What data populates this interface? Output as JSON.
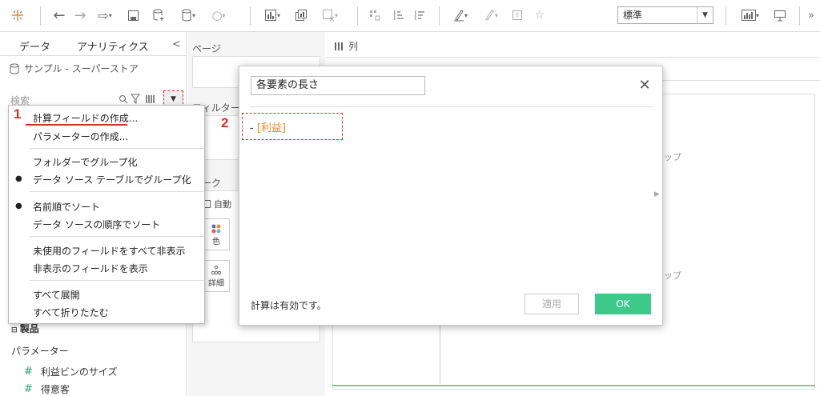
{
  "toolbar": {
    "style_select_value": "標準"
  },
  "left_pane": {
    "tabs": [
      {
        "label": "データ"
      },
      {
        "label": "アナリティクス"
      }
    ],
    "collapse_glyph": "<",
    "datasource": "サンプル - スーパーストア",
    "search_placeholder": "検索",
    "folded_row": "製品",
    "parameters_header": "パラメーター",
    "parameters": [
      {
        "label": "利益ビンのサイズ"
      },
      {
        "label": "得意客"
      }
    ]
  },
  "context_menu": {
    "items": [
      {
        "label": "計算フィールドの作成..."
      },
      {
        "label": "パラメーターの作成..."
      },
      {
        "label": "フォルダーでグループ化"
      },
      {
        "label": "データ ソース テーブルでグループ化"
      },
      {
        "label": "名前順でソート"
      },
      {
        "label": "データ ソースの順序でソート"
      },
      {
        "label": "未使用のフィールドをすべて非表示"
      },
      {
        "label": "非表示のフィールドを表示"
      },
      {
        "label": "すべて展開"
      },
      {
        "label": "すべて折りたたむ"
      }
    ]
  },
  "steps": {
    "step1": "1",
    "step2": "2"
  },
  "mid_pane": {
    "pages_title": "ページ",
    "filters_title": "フィルター",
    "marks_title": "マーク",
    "marks_type": "自動",
    "color_label": "色",
    "detail_label": "詳細"
  },
  "canvas": {
    "columns_label": "列",
    "partial_label_1": "ップ",
    "partial_label_2": "ップ"
  },
  "dialog": {
    "calc_name": "各要素の長さ",
    "close_glyph": "✕",
    "formula_prefix": "-",
    "formula_field": "[利益]",
    "valid_message": "計算は有効です。",
    "apply_label": "適用",
    "ok_label": "OK"
  },
  "colors": {
    "accent_red": "#d9302c",
    "ok_green": "#3cc98a",
    "field_orange": "#e8892a",
    "param_hash": "#2d9d78"
  }
}
